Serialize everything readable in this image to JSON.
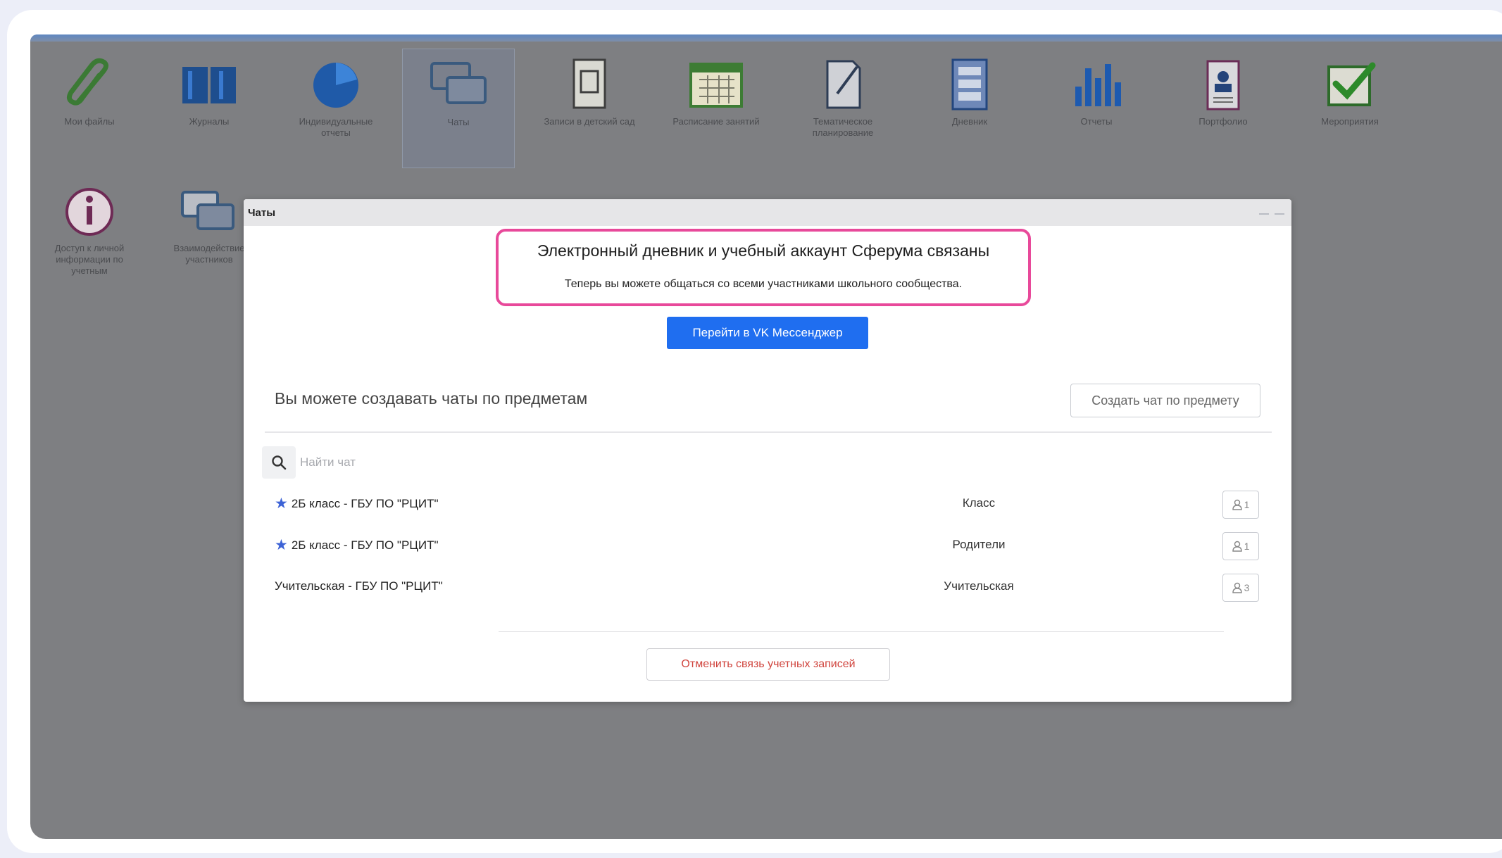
{
  "desktop": {
    "icons": [
      {
        "label": "Мои файлы"
      },
      {
        "label": "Журналы"
      },
      {
        "label": "Индивидуальные отчеты"
      },
      {
        "label": "Чаты"
      },
      {
        "label": "Записи в детский сад"
      },
      {
        "label": "Расписание занятий"
      },
      {
        "label": "Тематическое планирование"
      },
      {
        "label": "Дневник"
      },
      {
        "label": "Отчеты"
      },
      {
        "label": "Портфолио"
      },
      {
        "label": "Мероприятия"
      },
      {
        "label": "Доступ к личной информации по учетным"
      },
      {
        "label": "Взаимодействие участников"
      }
    ]
  },
  "modal": {
    "title": "Чаты",
    "linked_title": "Электронный дневник и учебный аккаунт Сферума связаны",
    "linked_subtitle": "Теперь вы можете общаться со всеми участниками школьного сообщества.",
    "vk_button": "Перейти в VK Мессенджер",
    "info_text": "Вы можете создавать чаты по предметам",
    "create_button": "Создать чат по предмету",
    "search_placeholder": "Найти чат",
    "chats": [
      {
        "name": "2Б класс - ГБУ ПО \"РЦИТ\"",
        "type": "Класс",
        "members": "1",
        "starred": true
      },
      {
        "name": "2Б класс - ГБУ ПО \"РЦИТ\"",
        "type": "Родители",
        "members": "1",
        "starred": true
      },
      {
        "name": "Учительская - ГБУ ПО \"РЦИТ\"",
        "type": "Учительская",
        "members": "3",
        "starred": false
      }
    ],
    "unlink_button": "Отменить связь учетных записей"
  },
  "colors": {
    "highlight": "#e8499a",
    "primary_button": "#1f6ef0",
    "star": "#3d63d6",
    "danger_text": "#d0443d"
  }
}
